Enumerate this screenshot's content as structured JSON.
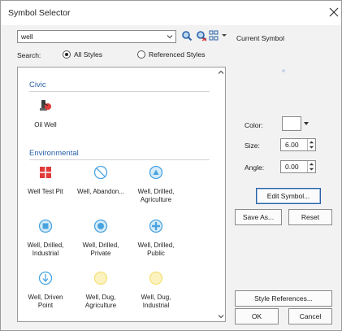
{
  "window": {
    "title": "Symbol Selector"
  },
  "search": {
    "value": "well",
    "label": "Search:"
  },
  "scope_options": [
    {
      "label": "All Styles",
      "selected": true
    },
    {
      "label": "Referenced Styles",
      "selected": false
    }
  ],
  "toolbar": {
    "icons": [
      "search-icon",
      "clear-search-icon",
      "view-options-icon"
    ]
  },
  "current_symbol": {
    "label": "Current Symbol"
  },
  "groups": [
    {
      "title": "Civic",
      "items": [
        {
          "label": "Oil Well",
          "icon": "oil-well-icon"
        }
      ]
    },
    {
      "title": "Environmental",
      "items": [
        {
          "label": "Well Test Pit",
          "icon": "well-test-pit-icon"
        },
        {
          "label": "Well, Abandon...",
          "icon": "well-abandoned-icon"
        },
        {
          "label": "Well, Drilled, Agriculture",
          "icon": "well-drilled-agriculture-icon"
        },
        {
          "label": "Well, Drilled, Industrial",
          "icon": "well-drilled-industrial-icon"
        },
        {
          "label": "Well, Drilled, Private",
          "icon": "well-drilled-private-icon"
        },
        {
          "label": "Well, Drilled, Public",
          "icon": "well-drilled-public-icon"
        },
        {
          "label": "Well, Driven Point",
          "icon": "well-driven-point-icon"
        },
        {
          "label": "Well, Dug, Agriculture",
          "icon": "well-dug-agriculture-icon"
        },
        {
          "label": "Well, Dug, Industrial",
          "icon": "well-dug-industrial-icon"
        }
      ]
    }
  ],
  "properties": {
    "color": {
      "label": "Color:"
    },
    "size": {
      "label": "Size:",
      "value": "6.00"
    },
    "angle": {
      "label": "Angle:",
      "value": "0.00"
    }
  },
  "buttons": {
    "edit_symbol": "Edit Symbol...",
    "save_as": "Save As...",
    "reset": "Reset",
    "style_references": "Style References...",
    "ok": "OK",
    "cancel": "Cancel"
  },
  "colors": {
    "accent": "#2a62a8",
    "group_title": "#2a62a8",
    "icon_blue": "#4aa3df",
    "icon_red": "#e03a3a",
    "icon_yellow": "#f4e27a"
  }
}
